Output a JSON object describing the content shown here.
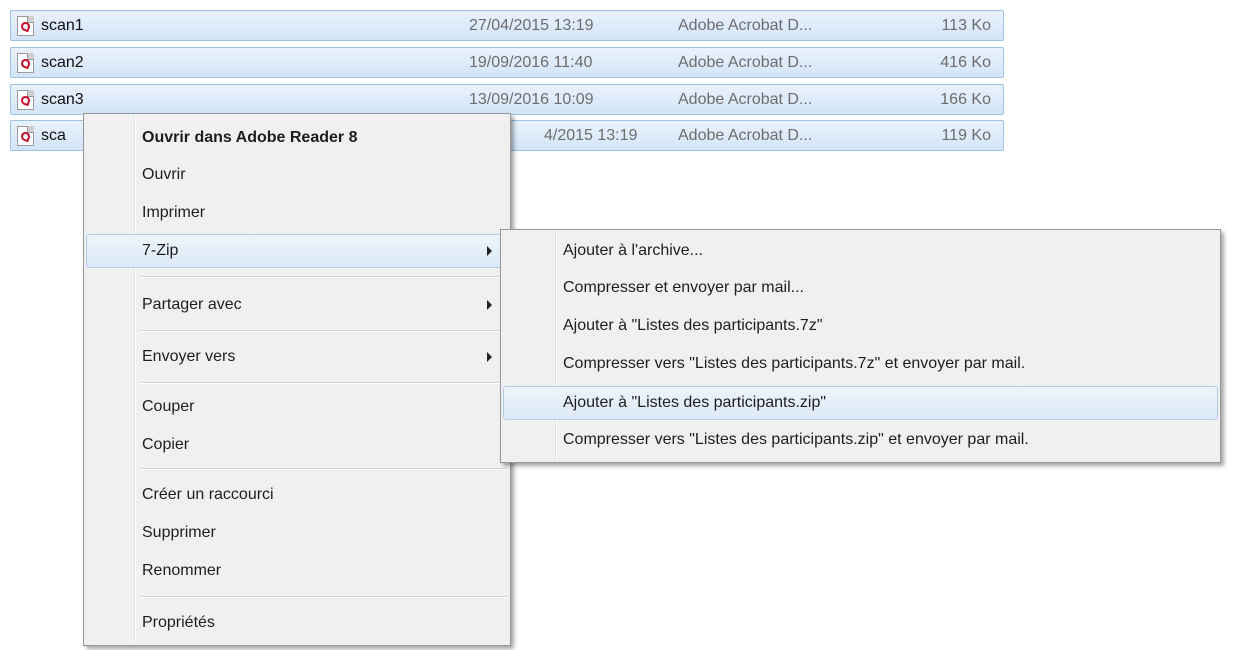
{
  "files": [
    {
      "name": "scan1",
      "date": "27/04/2015 13:19",
      "type": "Adobe Acrobat D...",
      "size": "113 Ko",
      "icon": "pdf-icon"
    },
    {
      "name": "scan2",
      "date": "19/09/2016 11:40",
      "type": "Adobe Acrobat D...",
      "size": "416 Ko",
      "icon": "pdf-icon"
    },
    {
      "name": "scan3",
      "date": "13/09/2016 10:09",
      "type": "Adobe Acrobat D...",
      "size": "166 Ko",
      "icon": "pdf-icon"
    },
    {
      "name": "sca",
      "date": "4/2015 13:19",
      "type": "Adobe Acrobat D...",
      "size": "119 Ko",
      "icon": "pdf-icon"
    }
  ],
  "context_menu": {
    "items": [
      {
        "label": "Ouvrir dans Adobe Reader 8"
      },
      {
        "label": "Ouvrir"
      },
      {
        "label": "Imprimer"
      },
      {
        "label": "7-Zip"
      },
      {
        "label": "Partager avec"
      },
      {
        "label": "Envoyer vers"
      },
      {
        "label": "Couper"
      },
      {
        "label": "Copier"
      },
      {
        "label": "Créer un raccourci"
      },
      {
        "label": "Supprimer"
      },
      {
        "label": "Renommer"
      },
      {
        "label": "Propriétés"
      }
    ]
  },
  "submenu_7zip": {
    "items": [
      {
        "label": "Ajouter à l'archive..."
      },
      {
        "label": "Compresser et envoyer par mail..."
      },
      {
        "label": "Ajouter à \"Listes des participants.7z\""
      },
      {
        "label": "Compresser vers \"Listes des participants.7z\" et envoyer par mail."
      },
      {
        "label": "Ajouter à \"Listes des participants.zip\""
      },
      {
        "label": "Compresser vers \"Listes des participants.zip\" et envoyer par mail."
      }
    ]
  },
  "colors": {
    "selection_fill": "#d3e5f8",
    "selection_border": "#9dc2e8",
    "menu_bg": "#f0f0f0",
    "pdf_red": "#c8102e"
  }
}
